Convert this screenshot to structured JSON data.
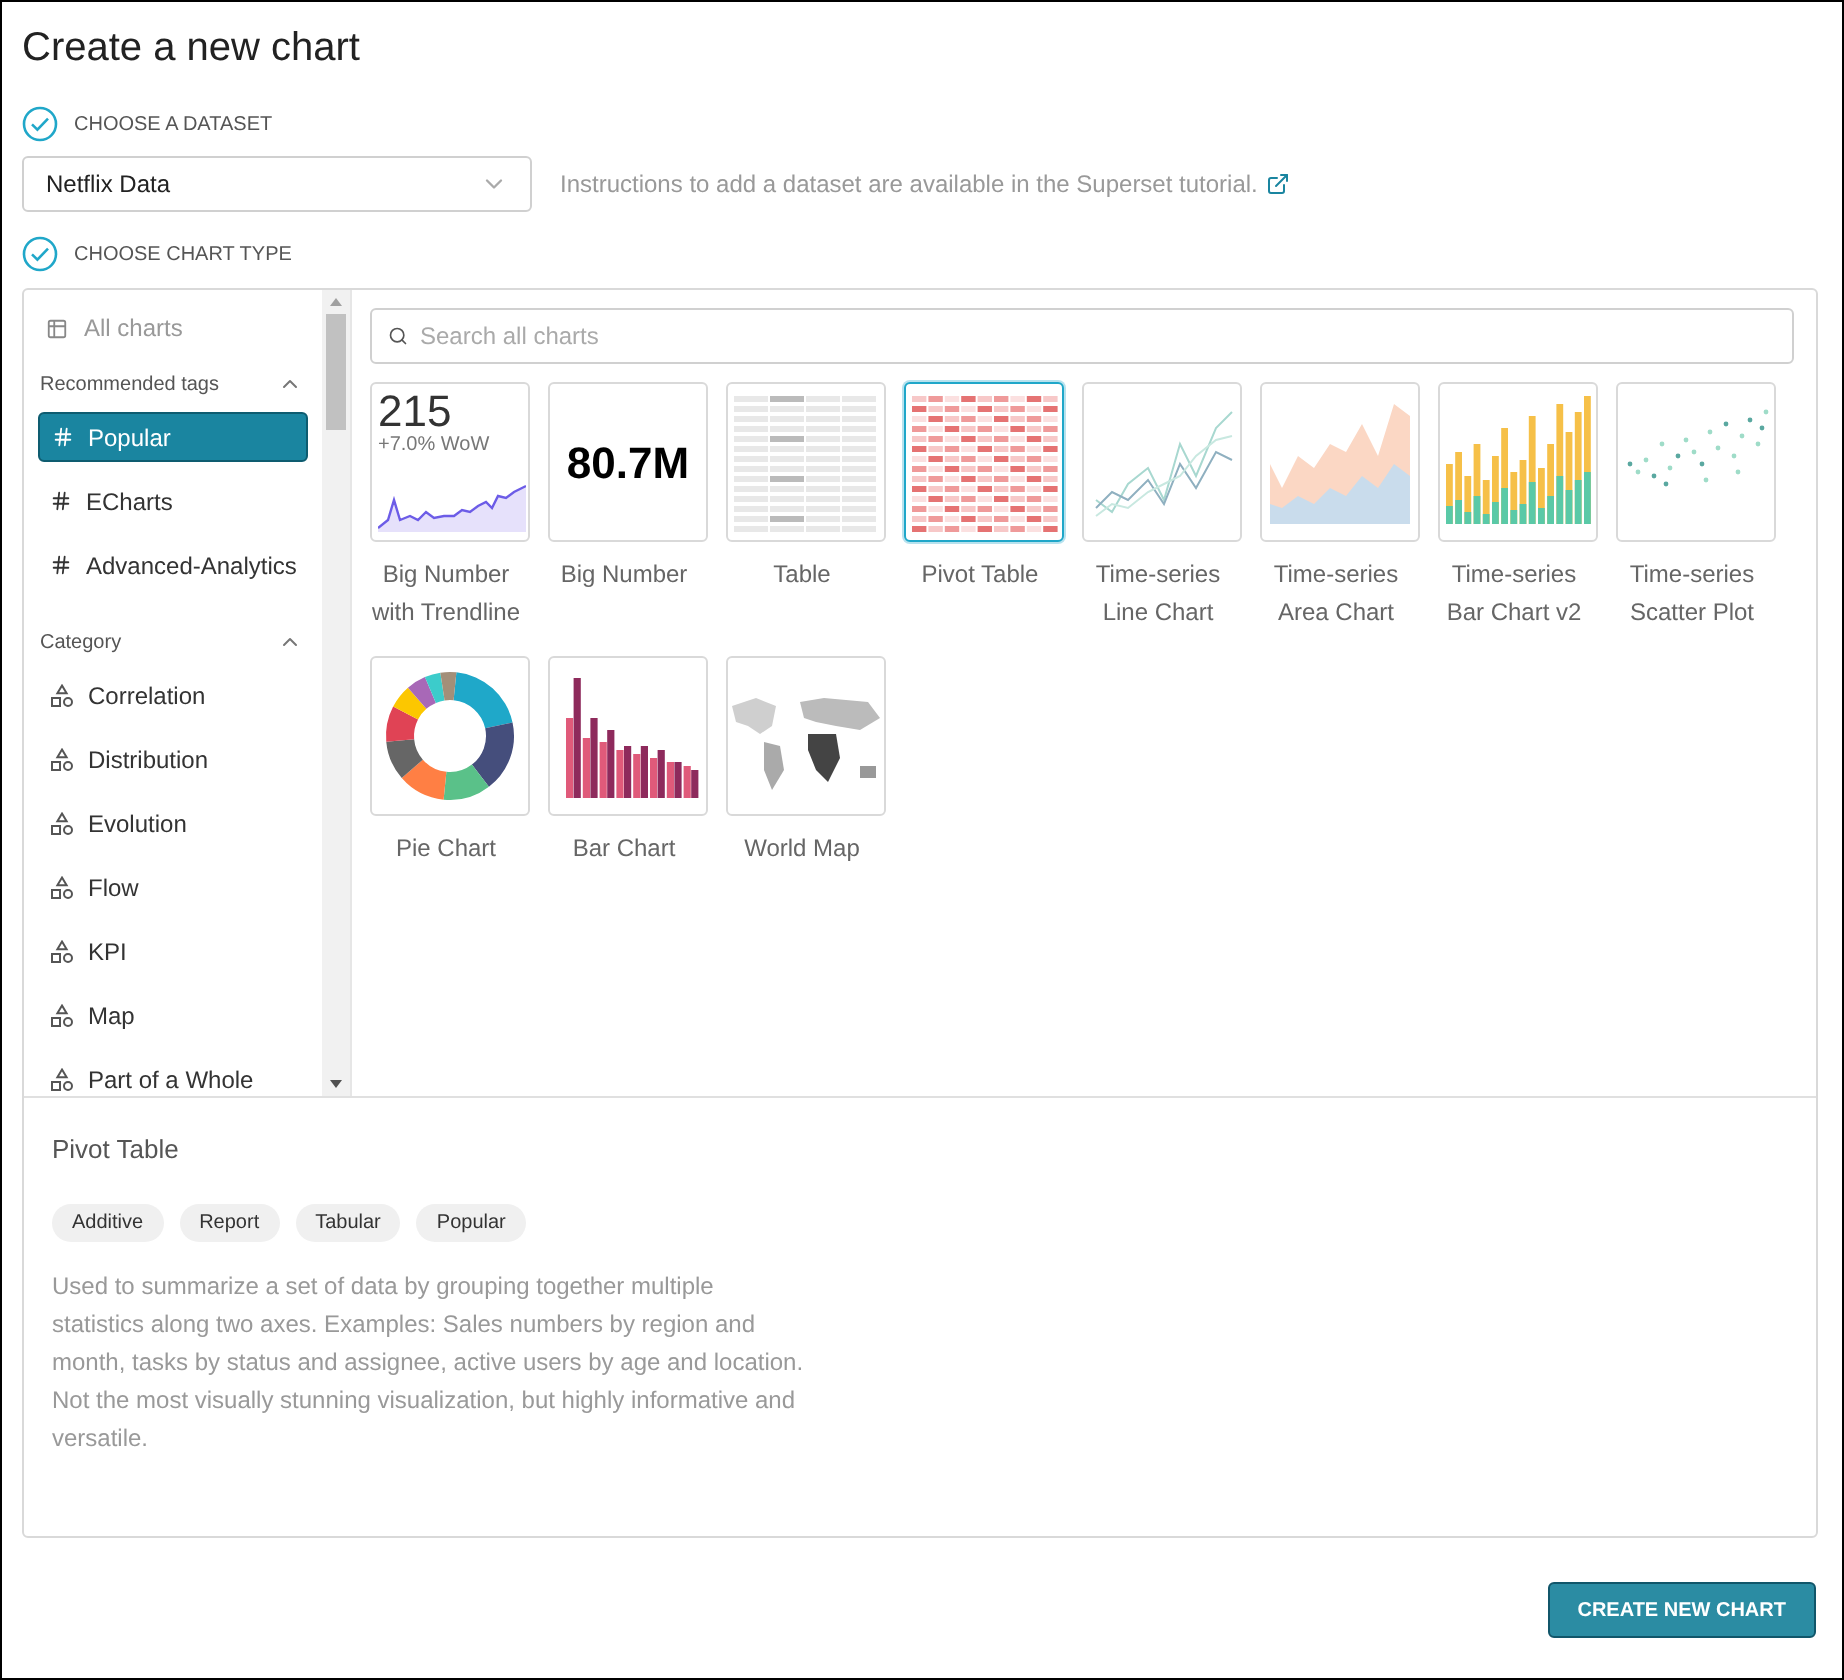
{
  "title": "Create a new chart",
  "dataset_step": {
    "label": "CHOOSE A DATASET"
  },
  "dataset_select": {
    "value": "Netflix Data"
  },
  "dataset_hint": "Instructions to add a dataset are available in the Superset tutorial.",
  "chart_type_step": {
    "label": "CHOOSE CHART TYPE"
  },
  "sidebar": {
    "all_charts": "All charts",
    "sections": [
      {
        "title": "Recommended tags",
        "expanded": true,
        "kind": "tag",
        "items": [
          {
            "label": "Popular",
            "selected": true
          },
          {
            "label": "ECharts",
            "selected": false
          },
          {
            "label": "Advanced-Analytics",
            "selected": false
          }
        ]
      },
      {
        "title": "Category",
        "expanded": true,
        "kind": "category",
        "items": [
          {
            "label": "Correlation",
            "selected": false
          },
          {
            "label": "Distribution",
            "selected": false
          },
          {
            "label": "Evolution",
            "selected": false
          },
          {
            "label": "Flow",
            "selected": false
          },
          {
            "label": "KPI",
            "selected": false
          },
          {
            "label": "Map",
            "selected": false
          },
          {
            "label": "Part of a Whole",
            "selected": false
          }
        ]
      }
    ]
  },
  "search": {
    "placeholder": "Search all charts"
  },
  "charts": [
    {
      "name": "Big Number with Trendline",
      "kind": "trendline",
      "selected": false,
      "number": "215",
      "subtitle": "+7.0% WoW"
    },
    {
      "name": "Big Number",
      "kind": "big-number",
      "selected": false,
      "number": "80.7M"
    },
    {
      "name": "Table",
      "kind": "table",
      "selected": false
    },
    {
      "name": "Pivot Table",
      "kind": "pivot",
      "selected": true
    },
    {
      "name": "Time-series Line Chart",
      "kind": "line",
      "selected": false
    },
    {
      "name": "Time-series Area Chart",
      "kind": "area",
      "selected": false
    },
    {
      "name": "Time-series Bar Chart v2",
      "kind": "stacked-bar",
      "selected": false
    },
    {
      "name": "Time-series Scatter Plot",
      "kind": "scatter",
      "selected": false
    },
    {
      "name": "Pie Chart",
      "kind": "donut",
      "selected": false
    },
    {
      "name": "Bar Chart",
      "kind": "bar",
      "selected": false
    },
    {
      "name": "World Map",
      "kind": "map",
      "selected": false
    }
  ],
  "details": {
    "title": "Pivot Table",
    "tags": [
      "Additive",
      "Report",
      "Tabular",
      "Popular"
    ],
    "description": "Used to summarize a set of data by grouping together multiple statistics along two axes. Examples: Sales numbers by region and month, tasks by status and assignee, active users by age and location. Not the most visually stunning visualization, but highly informative and versatile."
  },
  "create_button": "CREATE NEW CHART"
}
